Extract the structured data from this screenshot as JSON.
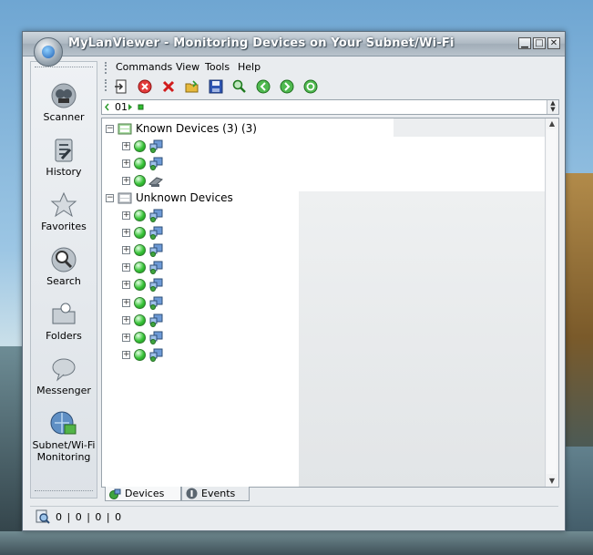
{
  "window": {
    "title": "MyLanViewer - Monitoring Devices on Your Subnet/Wi-Fi",
    "controls": {
      "minimize": "▁",
      "maximize": "□",
      "close": "✕"
    }
  },
  "sidebar": {
    "items": [
      {
        "label": "Scanner",
        "icon": "scanner-icon"
      },
      {
        "label": "History",
        "icon": "history-icon"
      },
      {
        "label": "Favorites",
        "icon": "star-icon"
      },
      {
        "label": "Search",
        "icon": "search-icon"
      },
      {
        "label": "Folders",
        "icon": "folders-icon"
      },
      {
        "label": "Messenger",
        "icon": "messenger-icon"
      },
      {
        "label": "Subnet/Wi-Fi",
        "label2": "Monitoring",
        "icon": "monitoring-icon"
      }
    ]
  },
  "menu": {
    "items": [
      "Commands",
      "View",
      "Tools",
      "Help"
    ]
  },
  "toolbar": {
    "buttons": [
      "import-icon",
      "stop-icon",
      "delete-icon",
      "open-folder-icon",
      "save-icon",
      "find-icon",
      "back-icon",
      "forward-icon",
      "refresh-icon"
    ]
  },
  "addressbar": {
    "value": "01"
  },
  "tree": {
    "known": {
      "label": "Known Devices (3) (3)",
      "expander": "−",
      "child_count": 3
    },
    "unknown": {
      "label": "Unknown Devices",
      "expander": "−",
      "child_count": 9
    },
    "child_expander": "+"
  },
  "tabs": [
    {
      "label": "Devices",
      "icon": "devices-icon",
      "active": true
    },
    {
      "label": "Events",
      "icon": "events-icon",
      "active": false
    }
  ],
  "status": {
    "text": "0 | 0 | 0 | 0"
  },
  "colors": {
    "status_green": "#36c236",
    "title_text": "#ffffff",
    "accent_blue": "#1f5fb3"
  }
}
